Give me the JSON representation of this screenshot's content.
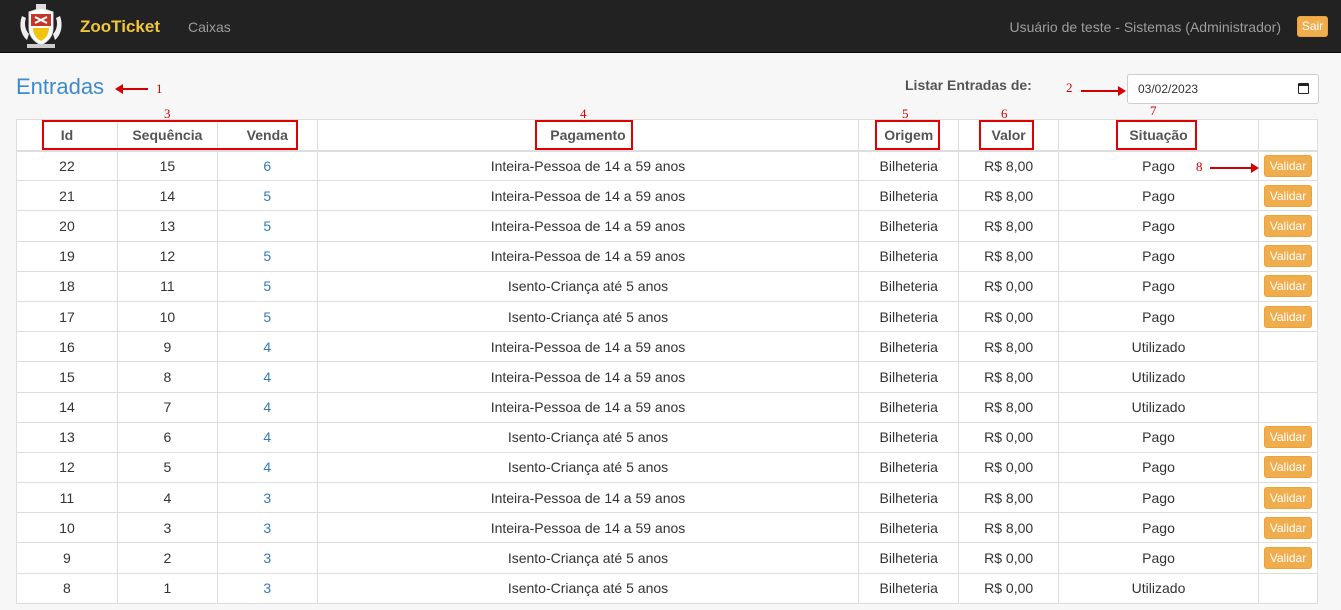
{
  "navbar": {
    "brand": "ZooTicket",
    "nav_link": "Caixas",
    "user": "Usuário de teste - Sistemas (Administrador)",
    "logout_label": "Sair",
    "logo_icon": "coat-of-arms-logo"
  },
  "page": {
    "title": "Entradas",
    "filter_label": "Listar Entradas de:",
    "date_value": "03/02/2023"
  },
  "table": {
    "headers": [
      "Id",
      "Sequência",
      "Venda",
      "Pagamento",
      "Origem",
      "Valor",
      "Situação",
      ""
    ],
    "action_label": "Validar",
    "rows": [
      {
        "id": "22",
        "seq": "15",
        "venda": "6",
        "pagamento": "Inteira-Pessoa de 14 a 59 anos",
        "origem": "Bilheteria",
        "valor": "R$ 8,00",
        "situacao": "Pago",
        "validar": true
      },
      {
        "id": "21",
        "seq": "14",
        "venda": "5",
        "pagamento": "Inteira-Pessoa de 14 a 59 anos",
        "origem": "Bilheteria",
        "valor": "R$ 8,00",
        "situacao": "Pago",
        "validar": true
      },
      {
        "id": "20",
        "seq": "13",
        "venda": "5",
        "pagamento": "Inteira-Pessoa de 14 a 59 anos",
        "origem": "Bilheteria",
        "valor": "R$ 8,00",
        "situacao": "Pago",
        "validar": true
      },
      {
        "id": "19",
        "seq": "12",
        "venda": "5",
        "pagamento": "Inteira-Pessoa de 14 a 59 anos",
        "origem": "Bilheteria",
        "valor": "R$ 8,00",
        "situacao": "Pago",
        "validar": true
      },
      {
        "id": "18",
        "seq": "11",
        "venda": "5",
        "pagamento": "Isento-Criança até 5 anos",
        "origem": "Bilheteria",
        "valor": "R$ 0,00",
        "situacao": "Pago",
        "validar": true
      },
      {
        "id": "17",
        "seq": "10",
        "venda": "5",
        "pagamento": "Isento-Criança até 5 anos",
        "origem": "Bilheteria",
        "valor": "R$ 0,00",
        "situacao": "Pago",
        "validar": true
      },
      {
        "id": "16",
        "seq": "9",
        "venda": "4",
        "pagamento": "Inteira-Pessoa de 14 a 59 anos",
        "origem": "Bilheteria",
        "valor": "R$ 8,00",
        "situacao": "Utilizado",
        "validar": false
      },
      {
        "id": "15",
        "seq": "8",
        "venda": "4",
        "pagamento": "Inteira-Pessoa de 14 a 59 anos",
        "origem": "Bilheteria",
        "valor": "R$ 8,00",
        "situacao": "Utilizado",
        "validar": false
      },
      {
        "id": "14",
        "seq": "7",
        "venda": "4",
        "pagamento": "Inteira-Pessoa de 14 a 59 anos",
        "origem": "Bilheteria",
        "valor": "R$ 8,00",
        "situacao": "Utilizado",
        "validar": false
      },
      {
        "id": "13",
        "seq": "6",
        "venda": "4",
        "pagamento": "Isento-Criança até 5 anos",
        "origem": "Bilheteria",
        "valor": "R$ 0,00",
        "situacao": "Pago",
        "validar": true
      },
      {
        "id": "12",
        "seq": "5",
        "venda": "4",
        "pagamento": "Isento-Criança até 5 anos",
        "origem": "Bilheteria",
        "valor": "R$ 0,00",
        "situacao": "Pago",
        "validar": true
      },
      {
        "id": "11",
        "seq": "4",
        "venda": "3",
        "pagamento": "Inteira-Pessoa de 14 a 59 anos",
        "origem": "Bilheteria",
        "valor": "R$ 8,00",
        "situacao": "Pago",
        "validar": true
      },
      {
        "id": "10",
        "seq": "3",
        "venda": "3",
        "pagamento": "Inteira-Pessoa de 14 a 59 anos",
        "origem": "Bilheteria",
        "valor": "R$ 8,00",
        "situacao": "Pago",
        "validar": true
      },
      {
        "id": "9",
        "seq": "2",
        "venda": "3",
        "pagamento": "Isento-Criança até 5 anos",
        "origem": "Bilheteria",
        "valor": "R$ 0,00",
        "situacao": "Pago",
        "validar": true
      },
      {
        "id": "8",
        "seq": "1",
        "venda": "3",
        "pagamento": "Isento-Criança até 5 anos",
        "origem": "Bilheteria",
        "valor": "R$ 0,00",
        "situacao": "Utilizado",
        "validar": false
      }
    ]
  },
  "annotations": {
    "labels": [
      "1",
      "2",
      "3",
      "4",
      "5",
      "6",
      "7",
      "8"
    ],
    "color": "#d00000"
  },
  "colors": {
    "navbar": "#222222",
    "brand": "#f0c63a",
    "accent": "#f0ad4e",
    "title": "#3d8bcd",
    "link": "#337ab7"
  }
}
